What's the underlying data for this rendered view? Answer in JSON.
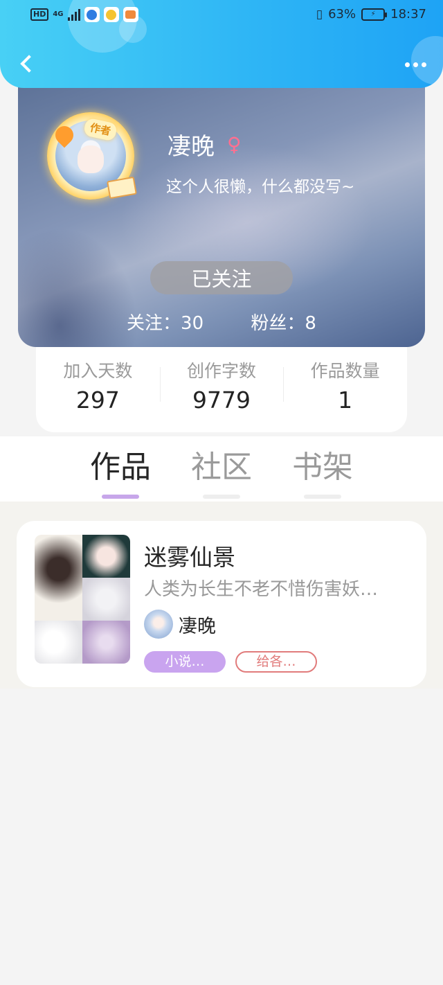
{
  "status_bar": {
    "network_badge": "HD",
    "network_type": "4G",
    "vibrate_icon": "vibrate-icon",
    "battery_percent": "63%",
    "time": "18:37",
    "app_icons": [
      "browser-app-icon",
      "emoji-app-icon",
      "game-app-icon"
    ]
  },
  "header": {
    "back_icon": "back-chevron-icon",
    "more_icon": "more-dots-icon",
    "colors": {
      "start": "#48d0f5",
      "end": "#1ea3f5"
    }
  },
  "profile": {
    "author_badge": "作者",
    "name": "凄晚",
    "gender_symbol": "♀",
    "bio": "这个人很懒，什么都没写~",
    "follow_button": "已关注",
    "following_label": "关注：",
    "following_count": "30",
    "fans_label": "粉丝：",
    "fans_count": "8"
  },
  "stats": [
    {
      "label": "加入天数",
      "value": "297"
    },
    {
      "label": "创作字数",
      "value": "9779"
    },
    {
      "label": "作品数量",
      "value": "1"
    }
  ],
  "tabs": [
    {
      "label": "作品",
      "active": true
    },
    {
      "label": "社区",
      "active": false
    },
    {
      "label": "书架",
      "active": false
    }
  ],
  "works": [
    {
      "title": "迷雾仙景",
      "description": "人类为长生不老不惜伤害妖…",
      "author": "凄晚",
      "tags": [
        "小说…",
        "给各…"
      ],
      "tag_colors": {
        "genre": "#c9a4ef",
        "theme": "#e17b7b"
      }
    }
  ]
}
